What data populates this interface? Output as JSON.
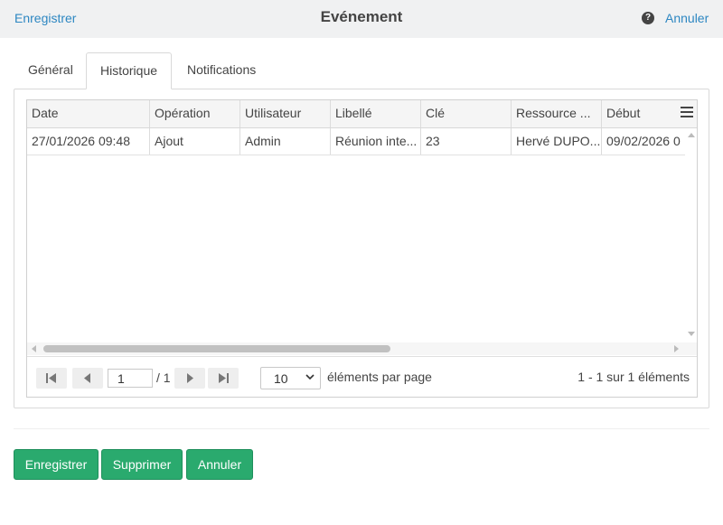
{
  "header": {
    "save_label": "Enregistrer",
    "title": "Evénement",
    "help_icon": "question-circle",
    "cancel_label": "Annuler"
  },
  "tabs": [
    {
      "label": "Général",
      "active": false
    },
    {
      "label": "Historique",
      "active": true
    },
    {
      "label": "Notifications",
      "active": false
    }
  ],
  "grid": {
    "columns": [
      "Date",
      "Opération",
      "Utilisateur",
      "Libellé",
      "Clé",
      "Ressource ...",
      "Début"
    ],
    "rows": [
      [
        "27/01/2026 09:48",
        "Ajout",
        "Admin",
        "Réunion inte...",
        "23",
        "Hervé DUPO...",
        "09/02/2026 0"
      ]
    ],
    "menu_icon": "hamburger-menu"
  },
  "pager": {
    "current_page": "1",
    "total_pages": "/ 1",
    "page_size": "10",
    "per_page_label": "éléments par page",
    "range_label": "1 - 1 sur 1 éléments"
  },
  "actions": {
    "save_label": "Enregistrer",
    "delete_label": "Supprimer",
    "cancel_label": "Annuler"
  },
  "colors": {
    "link": "#2d87c2",
    "primary_button": "#2aaa6e"
  }
}
